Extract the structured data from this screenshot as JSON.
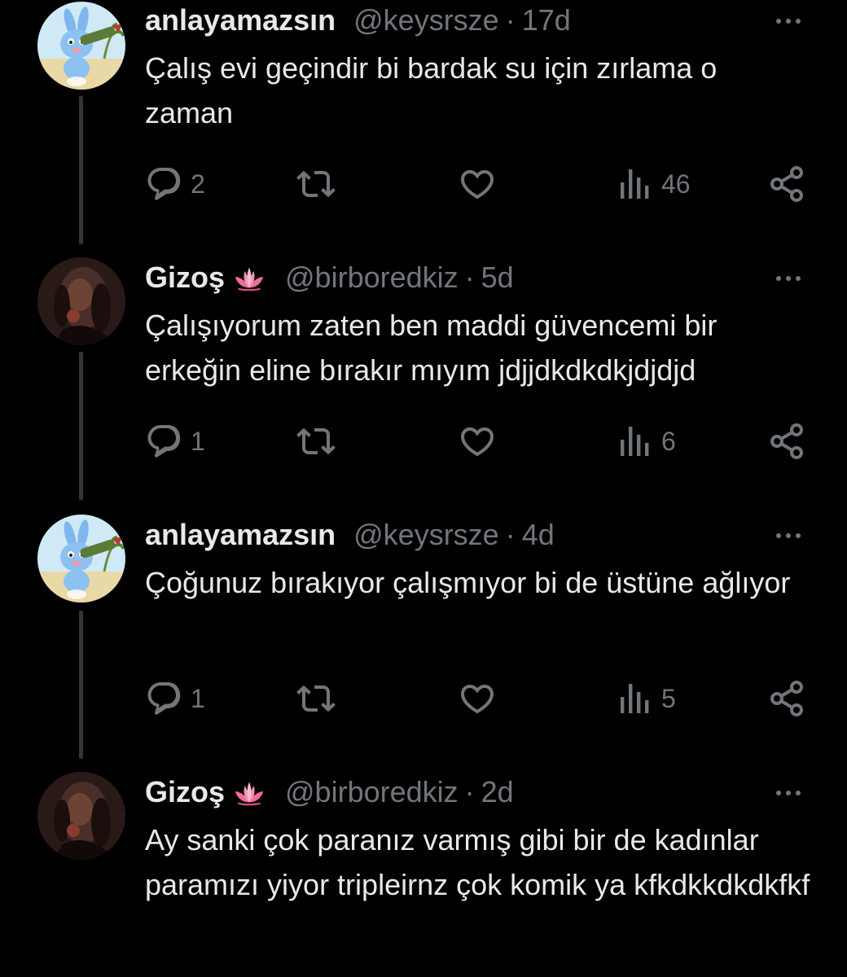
{
  "colors": {
    "background": "#000000",
    "text_primary": "#e7e9ea",
    "text_secondary": "#71767b",
    "thread_line": "#333639"
  },
  "tweets": [
    {
      "display_name": "anlayamazsın",
      "name_emoji": "",
      "handle": "@keysrsze",
      "separator": "·",
      "time": "17d",
      "text": "Çalış evi geçindir bi bardak su için zırlama o zaman",
      "avatar_icon": "bunny-avatar-icon",
      "replies": "2",
      "reposts": "",
      "likes": "",
      "views": "46"
    },
    {
      "display_name": "Gizoş",
      "name_emoji": "🪷",
      "handle": "@birboredkiz",
      "separator": "·",
      "time": "5d",
      "text": "Çalışıyorum zaten ben maddi güvencemi bir erkeğin eline bırakır mıyım jdjjdkdkdkjdjdjd",
      "avatar_icon": "dark-photo-avatar-icon",
      "replies": "1",
      "reposts": "",
      "likes": "",
      "views": "6"
    },
    {
      "display_name": "anlayamazsın",
      "name_emoji": "",
      "handle": "@keysrsze",
      "separator": "·",
      "time": "4d",
      "text": "Çoğunuz bırakıyor çalışmıyor bi de üstüne ağlıyor",
      "avatar_icon": "bunny-avatar-icon",
      "replies": "1",
      "reposts": "",
      "likes": "",
      "views": "5"
    },
    {
      "display_name": "Gizoş",
      "name_emoji": "🪷",
      "handle": "@birboredkiz",
      "separator": "·",
      "time": "2d",
      "text": "Ay sanki çok paranız varmış gibi bir de kadınlar paramızı yiyor tripleirnz çok komik ya kfkdkkdkdkfkf",
      "avatar_icon": "dark-photo-avatar-icon",
      "replies": "",
      "reposts": "",
      "likes": "",
      "views": ""
    }
  ]
}
